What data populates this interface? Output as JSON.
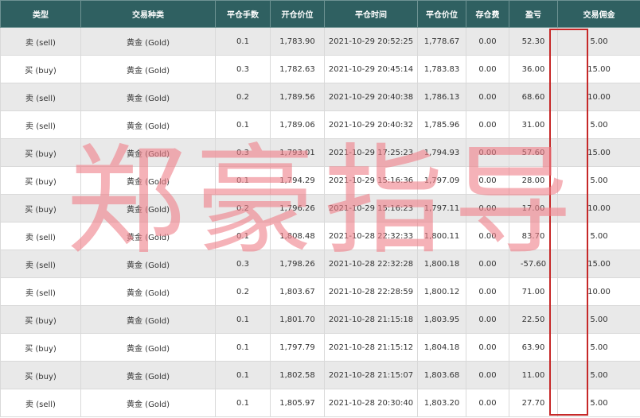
{
  "headers": [
    "类型",
    "交易种类",
    "平仓手数",
    "开仓价位",
    "平仓时间",
    "平仓价位",
    "存仓费",
    "盈亏",
    "交易佣金"
  ],
  "rows": [
    [
      "卖 (sell)",
      "黄金 (Gold)",
      "0.1",
      "1,783.90",
      "2021-10-29 20:52:25",
      "1,778.67",
      "0.00",
      "52.30",
      "5.00"
    ],
    [
      "买 (buy)",
      "黄金 (Gold)",
      "0.3",
      "1,782.63",
      "2021-10-29 20:45:14",
      "1,783.83",
      "0.00",
      "36.00",
      "15.00"
    ],
    [
      "卖 (sell)",
      "黄金 (Gold)",
      "0.2",
      "1,789.56",
      "2021-10-29 20:40:38",
      "1,786.13",
      "0.00",
      "68.60",
      "10.00"
    ],
    [
      "卖 (sell)",
      "黄金 (Gold)",
      "0.1",
      "1,789.06",
      "2021-10-29 20:40:32",
      "1,785.96",
      "0.00",
      "31.00",
      "5.00"
    ],
    [
      "买 (buy)",
      "黄金 (Gold)",
      "0.3",
      "1,793.01",
      "2021-10-29 17:25:23",
      "1,794.93",
      "0.00",
      "57.60",
      "15.00"
    ],
    [
      "买 (buy)",
      "黄金 (Gold)",
      "0.1",
      "1,794.29",
      "2021-10-29 15:16:36",
      "1,797.09",
      "0.00",
      "28.00",
      "5.00"
    ],
    [
      "买 (buy)",
      "黄金 (Gold)",
      "0.2",
      "1,796.26",
      "2021-10-29 15:16:23",
      "1,797.11",
      "0.00",
      "17.00",
      "10.00"
    ],
    [
      "卖 (sell)",
      "黄金 (Gold)",
      "0.1",
      "1,808.48",
      "2021-10-28 22:32:33",
      "1,800.11",
      "0.00",
      "83.70",
      "5.00"
    ],
    [
      "卖 (sell)",
      "黄金 (Gold)",
      "0.3",
      "1,798.26",
      "2021-10-28 22:32:28",
      "1,800.18",
      "0.00",
      "-57.60",
      "15.00"
    ],
    [
      "卖 (sell)",
      "黄金 (Gold)",
      "0.2",
      "1,803.67",
      "2021-10-28 22:28:59",
      "1,800.12",
      "0.00",
      "71.00",
      "10.00"
    ],
    [
      "买 (buy)",
      "黄金 (Gold)",
      "0.1",
      "1,801.70",
      "2021-10-28 21:15:18",
      "1,803.95",
      "0.00",
      "22.50",
      "5.00"
    ],
    [
      "买 (buy)",
      "黄金 (Gold)",
      "0.1",
      "1,797.79",
      "2021-10-28 21:15:12",
      "1,804.18",
      "0.00",
      "63.90",
      "5.00"
    ],
    [
      "买 (buy)",
      "黄金 (Gold)",
      "0.1",
      "1,802.58",
      "2021-10-28 21:15:07",
      "1,803.68",
      "0.00",
      "11.00",
      "5.00"
    ],
    [
      "卖 (sell)",
      "黄金 (Gold)",
      "0.1",
      "1,805.97",
      "2021-10-28 20:30:40",
      "1,803.20",
      "0.00",
      "27.70",
      "5.00"
    ]
  ],
  "watermark": "郑豪指导",
  "colors": {
    "header_bg": "#2f6061",
    "highlight_border": "#c62828",
    "watermark": "#f08089"
  }
}
